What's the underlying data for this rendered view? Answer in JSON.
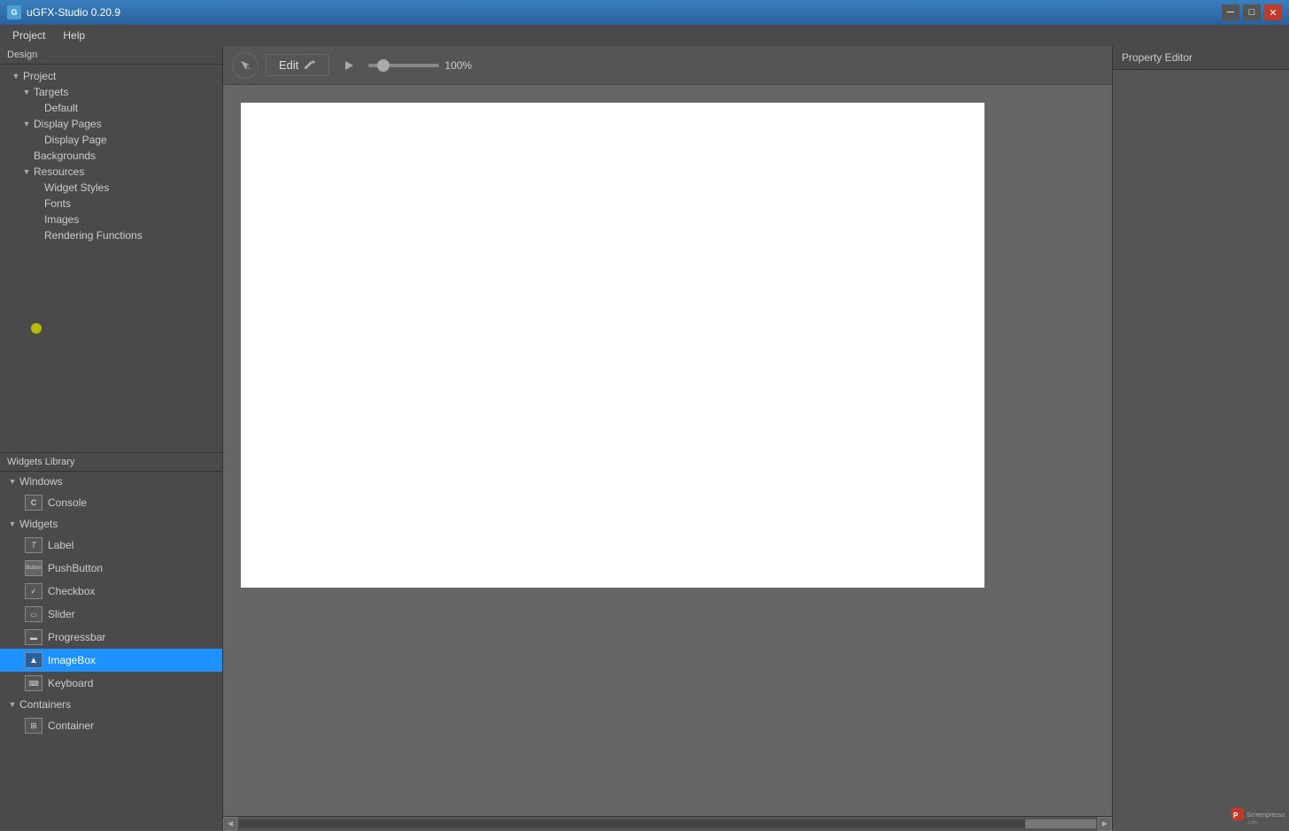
{
  "titlebar": {
    "title": "uGFX-Studio 0.20.9",
    "min_btn": "─",
    "max_btn": "□",
    "close_btn": "✕"
  },
  "menu": {
    "items": [
      "Project",
      "Help"
    ]
  },
  "left": {
    "design_label": "Design",
    "tree": {
      "project_label": "Project",
      "targets_label": "Targets",
      "default_label": "Default",
      "display_pages_label": "Display Pages",
      "display_page_label": "Display Page",
      "backgrounds_label": "Backgrounds",
      "resources_label": "Resources",
      "widget_styles_label": "Widget Styles",
      "fonts_label": "Fonts",
      "images_label": "Images",
      "rendering_functions_label": "Rendering Functions"
    },
    "widgets_label": "Widgets Library",
    "windows_section": "Windows",
    "console_label": "Console",
    "widgets_section": "Widgets",
    "widget_items": [
      {
        "label": "Label",
        "icon": "T"
      },
      {
        "label": "PushButton",
        "icon": "btn"
      },
      {
        "label": "Checkbox",
        "icon": "✓"
      },
      {
        "label": "Slider",
        "icon": "—"
      },
      {
        "label": "Progressbar",
        "icon": "▬"
      },
      {
        "label": "ImageBox",
        "icon": "▲"
      },
      {
        "label": "Keyboard",
        "icon": "⌨"
      }
    ],
    "containers_section": "Containers",
    "container_label": "Container",
    "container_icon": "⊞"
  },
  "toolbar": {
    "edit_label": "Edit",
    "zoom_value": "100%"
  },
  "property_editor": {
    "label": "Property Editor"
  },
  "canvas": {
    "bg": "white"
  }
}
